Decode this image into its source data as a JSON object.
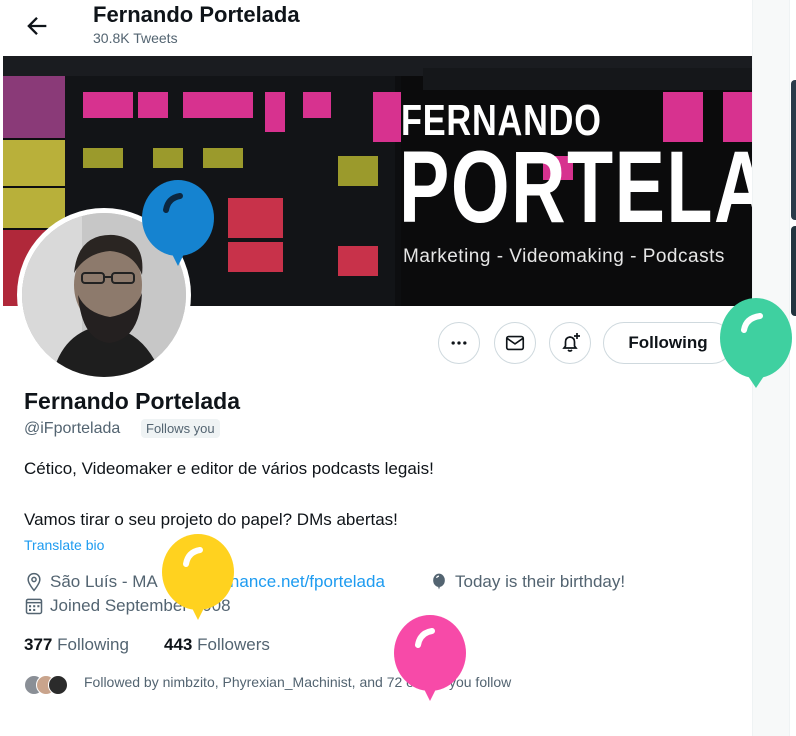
{
  "header": {
    "title": "Fernando Portelada",
    "tweet_count": "30.8K Tweets"
  },
  "banner": {
    "line1": "FERNANDO",
    "line2": "PORTELADA",
    "tagline": "Marketing - Videomaking - Podcasts"
  },
  "actions": {
    "following_label": "Following"
  },
  "profile": {
    "name": "Fernando Portelada",
    "handle": "@iFportelada",
    "follows_you": "Follows you",
    "bio_line1": "Cético, Videomaker e editor de vários podcasts legais!",
    "bio_line2": "Vamos tirar o seu projeto do papel? DMs abertas!",
    "translate": "Translate bio",
    "location": "São Luís - MA",
    "website": "behance.net/fportelada",
    "birthday": "Today is their birthday!",
    "joined": "Joined September 2008"
  },
  "stats": {
    "following_count": "377",
    "following_label": "Following",
    "followers_count": "443",
    "followers_label": "Followers"
  },
  "followed_by": "Followed by nimbzito, Phyrexian_Machinist, and 72 others you follow",
  "colors": {
    "accent": "#1d9bf0",
    "balloon_blue": "#1583d0",
    "balloon_green": "#3fd0a0",
    "balloon_yellow": "#ffd21f",
    "balloon_pink": "#f74aa8"
  }
}
